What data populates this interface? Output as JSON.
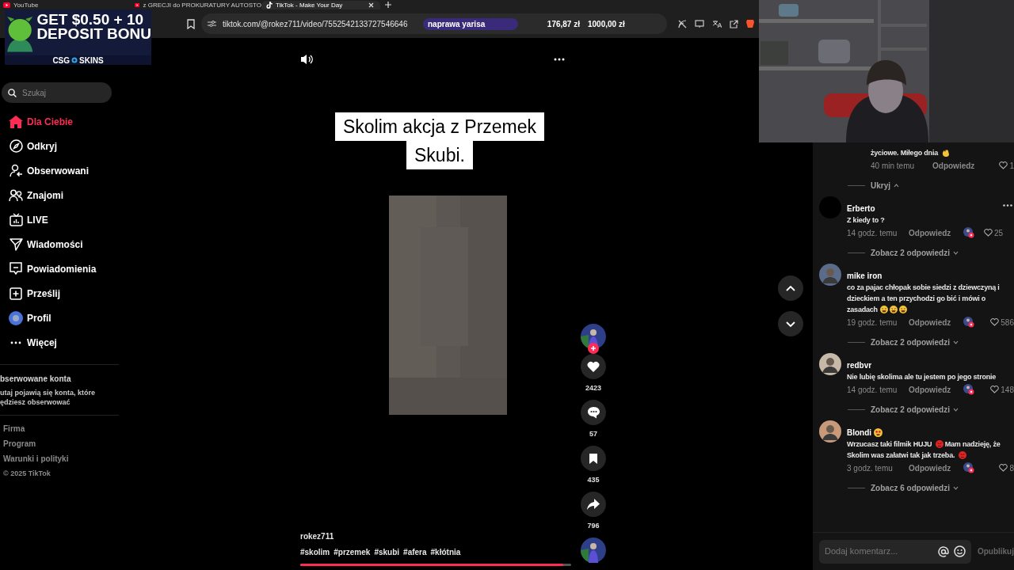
{
  "browser": {
    "tabs": [
      {
        "title": "YouTube",
        "kind": "youtube",
        "selected": false
      },
      {
        "title": "z GRECJI do PROKURATURY AUTOSTO",
        "kind": "youtube",
        "selected": false
      },
      {
        "title": "TikTok - Make Your Day",
        "kind": "tiktok",
        "selected": true
      }
    ],
    "url": "tiktok.com/@rokez711/video/7552542133727546646",
    "address_extras": [
      "naprawa yarisa",
      "176,87 zł",
      "1000,00 zł"
    ]
  },
  "ad_overlay": {
    "headline": "GET $0.50 + 10",
    "subline": "DEPOSIT BONU",
    "brand_left": "CSG",
    "brand_right": "SKINS"
  },
  "sidebar": {
    "search": {
      "placeholder": "Szukaj"
    },
    "items": [
      {
        "label": "Dla Ciebie",
        "kind": "home",
        "selected": true
      },
      {
        "label": "Odkryj",
        "kind": "compass",
        "selected": false
      },
      {
        "label": "Obserwowani",
        "kind": "following",
        "selected": false
      },
      {
        "label": "Znajomi",
        "kind": "friends",
        "selected": false
      },
      {
        "label": "LIVE",
        "kind": "live",
        "selected": false
      },
      {
        "label": "Wiadomości",
        "kind": "send",
        "selected": false
      },
      {
        "label": "Powiadomienia",
        "kind": "inbox",
        "selected": false
      },
      {
        "label": "Prześlij",
        "kind": "upload",
        "selected": false
      },
      {
        "label": "Profil",
        "kind": "avatar",
        "selected": false
      },
      {
        "label": "Więcej",
        "kind": "more",
        "selected": false
      }
    ],
    "following": {
      "title": "bserwowane konta",
      "lines": [
        "utaj pojawią się konta, które",
        "ędziesz obserwować"
      ]
    },
    "footer": [
      "Firma",
      "Program",
      "Warunki i polityki"
    ],
    "copyright": "© 2025 TikTok"
  },
  "video": {
    "caption_lines": [
      "Skolim akcja z Przemek",
      "Skubi."
    ],
    "author": "rokez711",
    "hashtags": [
      "#skolim",
      "#przemek",
      "#skubi",
      "#afera",
      "#kłótnia"
    ],
    "progress": {
      "level": 0.97
    },
    "actions": [
      {
        "kind": "like",
        "count": "2423"
      },
      {
        "kind": "comment",
        "count": "57"
      },
      {
        "kind": "save",
        "count": "435"
      },
      {
        "kind": "share",
        "count": "796"
      }
    ]
  },
  "comments": [
    {
      "kind": "reply",
      "body": [
        {
          "kind": "text",
          "text": "życiowe. Miłego dnia"
        },
        {
          "kind": "wave"
        }
      ],
      "time": "40 min temu",
      "reply": "Odpowiedz",
      "creator_liked": false,
      "likes": "1"
    },
    {
      "kind": "toggle",
      "label": "Ukryj",
      "expanded": true
    },
    {
      "kind": "comment",
      "author": "Erberto",
      "body": [
        {
          "kind": "text",
          "text": "Z kiedy to ?"
        }
      ],
      "time": "14 godz. temu",
      "reply": "Odpowiedz",
      "creator_liked": true,
      "likes": "25"
    },
    {
      "kind": "toggle",
      "label": "Zobacz 2 odpowiedzi",
      "expanded": false
    },
    {
      "kind": "comment",
      "author": "mike iron",
      "body": [
        {
          "kind": "text",
          "text": "co za pajac chłopak sobie siedzi z dziewczyną i dzieckiem a ten przychodzi go bić i mówi o zasadach"
        },
        {
          "kind": "laugh"
        },
        {
          "kind": "laugh"
        },
        {
          "kind": "laugh"
        }
      ],
      "time": "19 godz. temu",
      "reply": "Odpowiedz",
      "creator_liked": true,
      "likes": "586"
    },
    {
      "kind": "toggle",
      "label": "Zobacz 2 odpowiedzi",
      "expanded": false
    },
    {
      "kind": "comment",
      "author": "redbvr",
      "body": [
        {
          "kind": "text",
          "text": "Nie lubię skolima ale tu jestem po jego stronie"
        }
      ],
      "time": "14 godz. temu",
      "reply": "Odpowiedz",
      "creator_liked": true,
      "likes": "148"
    },
    {
      "kind": "toggle",
      "label": "Zobacz 2 odpowiedzi",
      "expanded": false
    },
    {
      "kind": "comment",
      "author": "Blondi",
      "author_emoji": {
        "kind": "heart_eyes"
      },
      "body": [
        {
          "kind": "text",
          "text": "Wrzucasz taki filmik HUJU"
        },
        {
          "kind": "angry"
        },
        {
          "kind": "text",
          "text": "Mam nadzieję, że Skolim was załatwi tak jak trzeba."
        },
        {
          "kind": "angry"
        }
      ],
      "time": "3 godz. temu",
      "reply": "Odpowiedz",
      "creator_liked": true,
      "likes": "8"
    },
    {
      "kind": "toggle",
      "label": "Zobacz 6 odpowiedzi",
      "expanded": false
    }
  ],
  "comment_input": {
    "placeholder": "Dodaj komentarz...",
    "submit": "Opublikuj",
    "disabled": true
  }
}
